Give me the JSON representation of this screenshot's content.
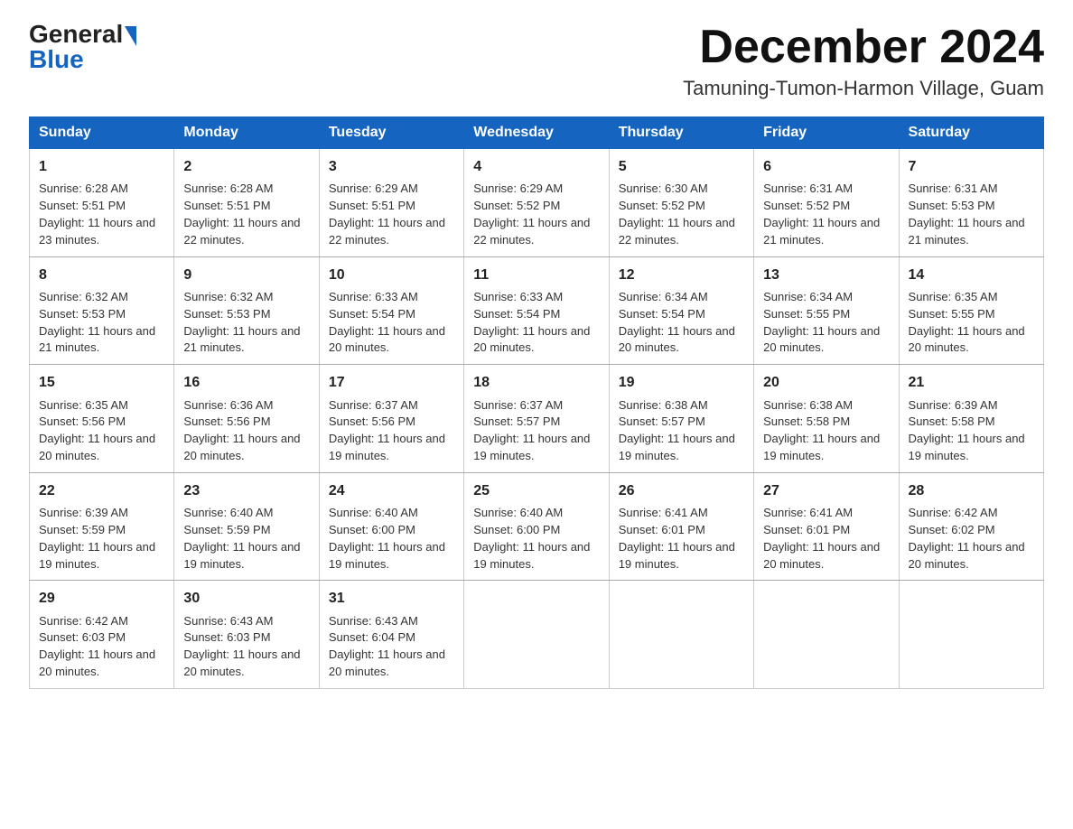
{
  "logo": {
    "text_general": "General",
    "text_blue": "Blue",
    "triangle": "▶"
  },
  "header": {
    "month_title": "December 2024",
    "location": "Tamuning-Tumon-Harmon Village, Guam"
  },
  "weekdays": [
    "Sunday",
    "Monday",
    "Tuesday",
    "Wednesday",
    "Thursday",
    "Friday",
    "Saturday"
  ],
  "weeks": [
    [
      {
        "day": "1",
        "sunrise": "6:28 AM",
        "sunset": "5:51 PM",
        "daylight": "11 hours and 23 minutes."
      },
      {
        "day": "2",
        "sunrise": "6:28 AM",
        "sunset": "5:51 PM",
        "daylight": "11 hours and 22 minutes."
      },
      {
        "day": "3",
        "sunrise": "6:29 AM",
        "sunset": "5:51 PM",
        "daylight": "11 hours and 22 minutes."
      },
      {
        "day": "4",
        "sunrise": "6:29 AM",
        "sunset": "5:52 PM",
        "daylight": "11 hours and 22 minutes."
      },
      {
        "day": "5",
        "sunrise": "6:30 AM",
        "sunset": "5:52 PM",
        "daylight": "11 hours and 22 minutes."
      },
      {
        "day": "6",
        "sunrise": "6:31 AM",
        "sunset": "5:52 PM",
        "daylight": "11 hours and 21 minutes."
      },
      {
        "day": "7",
        "sunrise": "6:31 AM",
        "sunset": "5:53 PM",
        "daylight": "11 hours and 21 minutes."
      }
    ],
    [
      {
        "day": "8",
        "sunrise": "6:32 AM",
        "sunset": "5:53 PM",
        "daylight": "11 hours and 21 minutes."
      },
      {
        "day": "9",
        "sunrise": "6:32 AM",
        "sunset": "5:53 PM",
        "daylight": "11 hours and 21 minutes."
      },
      {
        "day": "10",
        "sunrise": "6:33 AM",
        "sunset": "5:54 PM",
        "daylight": "11 hours and 20 minutes."
      },
      {
        "day": "11",
        "sunrise": "6:33 AM",
        "sunset": "5:54 PM",
        "daylight": "11 hours and 20 minutes."
      },
      {
        "day": "12",
        "sunrise": "6:34 AM",
        "sunset": "5:54 PM",
        "daylight": "11 hours and 20 minutes."
      },
      {
        "day": "13",
        "sunrise": "6:34 AM",
        "sunset": "5:55 PM",
        "daylight": "11 hours and 20 minutes."
      },
      {
        "day": "14",
        "sunrise": "6:35 AM",
        "sunset": "5:55 PM",
        "daylight": "11 hours and 20 minutes."
      }
    ],
    [
      {
        "day": "15",
        "sunrise": "6:35 AM",
        "sunset": "5:56 PM",
        "daylight": "11 hours and 20 minutes."
      },
      {
        "day": "16",
        "sunrise": "6:36 AM",
        "sunset": "5:56 PM",
        "daylight": "11 hours and 20 minutes."
      },
      {
        "day": "17",
        "sunrise": "6:37 AM",
        "sunset": "5:56 PM",
        "daylight": "11 hours and 19 minutes."
      },
      {
        "day": "18",
        "sunrise": "6:37 AM",
        "sunset": "5:57 PM",
        "daylight": "11 hours and 19 minutes."
      },
      {
        "day": "19",
        "sunrise": "6:38 AM",
        "sunset": "5:57 PM",
        "daylight": "11 hours and 19 minutes."
      },
      {
        "day": "20",
        "sunrise": "6:38 AM",
        "sunset": "5:58 PM",
        "daylight": "11 hours and 19 minutes."
      },
      {
        "day": "21",
        "sunrise": "6:39 AM",
        "sunset": "5:58 PM",
        "daylight": "11 hours and 19 minutes."
      }
    ],
    [
      {
        "day": "22",
        "sunrise": "6:39 AM",
        "sunset": "5:59 PM",
        "daylight": "11 hours and 19 minutes."
      },
      {
        "day": "23",
        "sunrise": "6:40 AM",
        "sunset": "5:59 PM",
        "daylight": "11 hours and 19 minutes."
      },
      {
        "day": "24",
        "sunrise": "6:40 AM",
        "sunset": "6:00 PM",
        "daylight": "11 hours and 19 minutes."
      },
      {
        "day": "25",
        "sunrise": "6:40 AM",
        "sunset": "6:00 PM",
        "daylight": "11 hours and 19 minutes."
      },
      {
        "day": "26",
        "sunrise": "6:41 AM",
        "sunset": "6:01 PM",
        "daylight": "11 hours and 19 minutes."
      },
      {
        "day": "27",
        "sunrise": "6:41 AM",
        "sunset": "6:01 PM",
        "daylight": "11 hours and 20 minutes."
      },
      {
        "day": "28",
        "sunrise": "6:42 AM",
        "sunset": "6:02 PM",
        "daylight": "11 hours and 20 minutes."
      }
    ],
    [
      {
        "day": "29",
        "sunrise": "6:42 AM",
        "sunset": "6:03 PM",
        "daylight": "11 hours and 20 minutes."
      },
      {
        "day": "30",
        "sunrise": "6:43 AM",
        "sunset": "6:03 PM",
        "daylight": "11 hours and 20 minutes."
      },
      {
        "day": "31",
        "sunrise": "6:43 AM",
        "sunset": "6:04 PM",
        "daylight": "11 hours and 20 minutes."
      },
      null,
      null,
      null,
      null
    ]
  ]
}
